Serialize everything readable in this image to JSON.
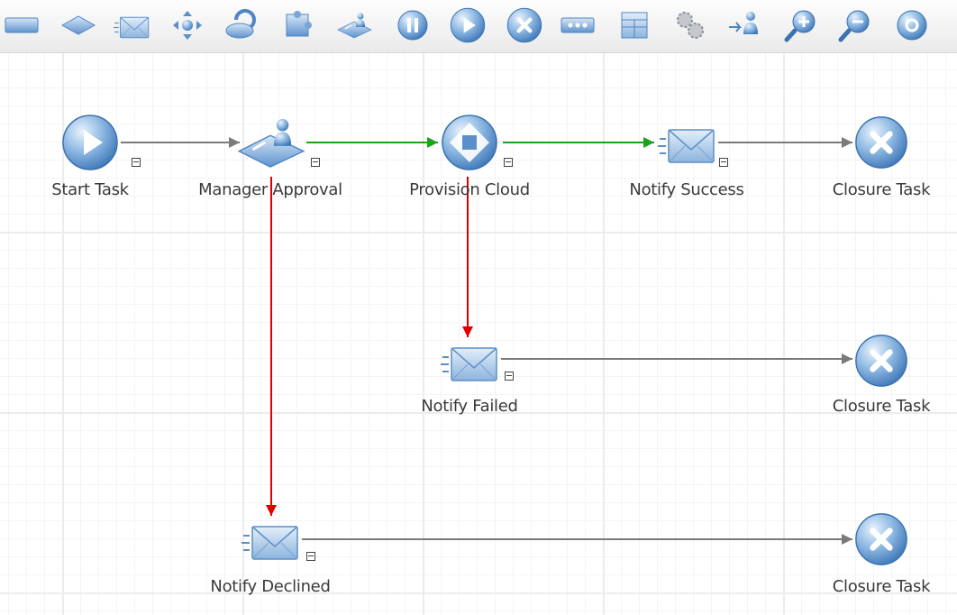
{
  "toolbar": {
    "buttons": [
      {
        "name": "task-tool",
        "icon": "task-bar-icon"
      },
      {
        "name": "decision-tool",
        "icon": "diamond-icon"
      },
      {
        "name": "email-tool",
        "icon": "email-icon"
      },
      {
        "name": "move-tool",
        "icon": "move-arrows-icon"
      },
      {
        "name": "sync-tool",
        "icon": "refresh-disk-icon"
      },
      {
        "name": "grid-tool",
        "icon": "puzzle-icon"
      },
      {
        "name": "approval-tool",
        "icon": "approval-icon"
      },
      {
        "name": "pause-tool",
        "icon": "pause-icon"
      },
      {
        "name": "start-tool",
        "icon": "start-icon"
      },
      {
        "name": "stop-tool",
        "icon": "stop-icon"
      },
      {
        "name": "ellipsis-tool",
        "icon": "ellipsis-icon"
      },
      {
        "name": "form-tool",
        "icon": "form-icon"
      },
      {
        "name": "settings-tool",
        "icon": "gears-icon"
      },
      {
        "name": "assign-tool",
        "icon": "assign-user-icon"
      },
      {
        "name": "zoom-in-tool",
        "icon": "zoom-in-icon"
      },
      {
        "name": "zoom-out-tool",
        "icon": "zoom-out-icon"
      },
      {
        "name": "fit-tool",
        "icon": "fit-icon"
      }
    ]
  },
  "colors": {
    "accent": "#4a86c8",
    "flow_default": "#7a7a7a",
    "flow_success": "#1aa31a",
    "flow_failure": "#e00000"
  },
  "workflow": {
    "nodes": [
      {
        "id": "start",
        "label": "Start Task",
        "icon": "start-icon"
      },
      {
        "id": "approval",
        "label": "Manager Approval",
        "icon": "approval-icon"
      },
      {
        "id": "provision",
        "label": "Provision Cloud",
        "icon": "provision-icon"
      },
      {
        "id": "notify-success",
        "label": "Notify Success",
        "icon": "email-icon"
      },
      {
        "id": "closure-1",
        "label": "Closure Task",
        "icon": "stop-icon"
      },
      {
        "id": "notify-failed",
        "label": "Notify Failed",
        "icon": "email-icon"
      },
      {
        "id": "closure-2",
        "label": "Closure Task",
        "icon": "stop-icon"
      },
      {
        "id": "notify-declined",
        "label": "Notify Declined",
        "icon": "email-icon"
      },
      {
        "id": "closure-3",
        "label": "Closure Task",
        "icon": "stop-icon"
      }
    ],
    "edges": [
      {
        "from": "start",
        "to": "approval",
        "status": "default"
      },
      {
        "from": "approval",
        "to": "provision",
        "status": "success"
      },
      {
        "from": "provision",
        "to": "notify-success",
        "status": "success"
      },
      {
        "from": "notify-success",
        "to": "closure-1",
        "status": "default"
      },
      {
        "from": "approval",
        "to": "notify-declined",
        "status": "failure"
      },
      {
        "from": "provision",
        "to": "notify-failed",
        "status": "failure"
      },
      {
        "from": "notify-failed",
        "to": "closure-2",
        "status": "default"
      },
      {
        "from": "notify-declined",
        "to": "closure-3",
        "status": "default"
      }
    ]
  }
}
